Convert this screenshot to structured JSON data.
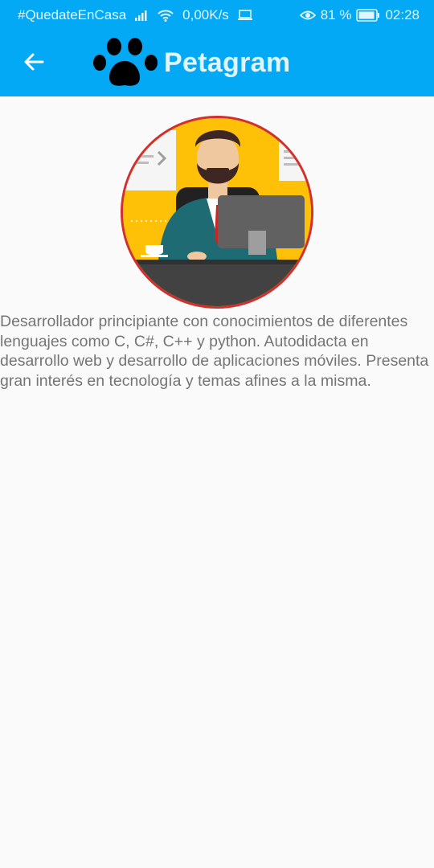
{
  "status_bar": {
    "carrier_hashtag": "#QuedateEnCasa",
    "network_speed": "0,00K/s",
    "battery_percent": "81 %",
    "time": "02:28",
    "icons": [
      "signal-icon",
      "wifi-icon",
      "laptop-icon",
      "eye-icon",
      "battery-icon"
    ]
  },
  "app_bar": {
    "title": "Petagram",
    "back_icon": "arrow-left-icon",
    "logo_icon": "paw-icon",
    "color": "#03a9f4"
  },
  "profile": {
    "photo_description_icon": "developer-avatar-icon",
    "border_color": "#d32f2f",
    "bio": "Desarrollador principiante con conocimientos de diferentes lenguajes como C, C#, C++ y python. Autodidacta en desarrollo web y desarrollo de aplicaciones móviles. Presenta gran interés en tecnología y temas afines a la misma."
  }
}
